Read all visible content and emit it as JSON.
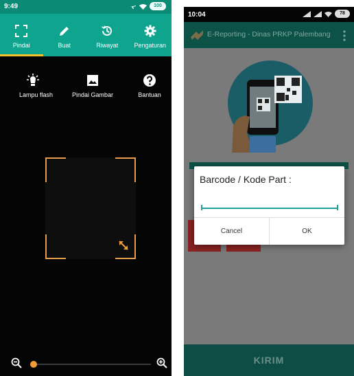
{
  "left_screen": {
    "status_time": "9:49",
    "status_battery": "100",
    "tabs": [
      {
        "label": "Pindai",
        "icon": "scan-icon"
      },
      {
        "label": "Buat",
        "icon": "pencil-icon"
      },
      {
        "label": "Riwayat",
        "icon": "history-icon"
      },
      {
        "label": "Pengaturan",
        "icon": "gear-icon"
      }
    ],
    "tools": [
      {
        "label": "Lampu flash",
        "icon": "flashlight-icon"
      },
      {
        "label": "Pindai Gambar",
        "icon": "image-icon"
      },
      {
        "label": "Bantuan",
        "icon": "help-icon"
      }
    ],
    "zoom_level": 0.0
  },
  "right_screen": {
    "status_time": "10:04",
    "status_battery": "78",
    "app_title": "E-Reporting - Dinas PRKP Palembang",
    "dialog": {
      "title": "Barcode / Kode Part :",
      "input_value": "",
      "cancel_label": "Cancel",
      "ok_label": "OK"
    },
    "bottom_button": "KIRIM"
  },
  "colors": {
    "left_appbar": "#0fa48e",
    "left_tab_indicator": "#f5c12a",
    "scan_frame": "#e89b4a",
    "zoom_knob": "#f29d35",
    "right_toolbar": "#0d5247",
    "dialog_underline": "#1fa09b"
  }
}
